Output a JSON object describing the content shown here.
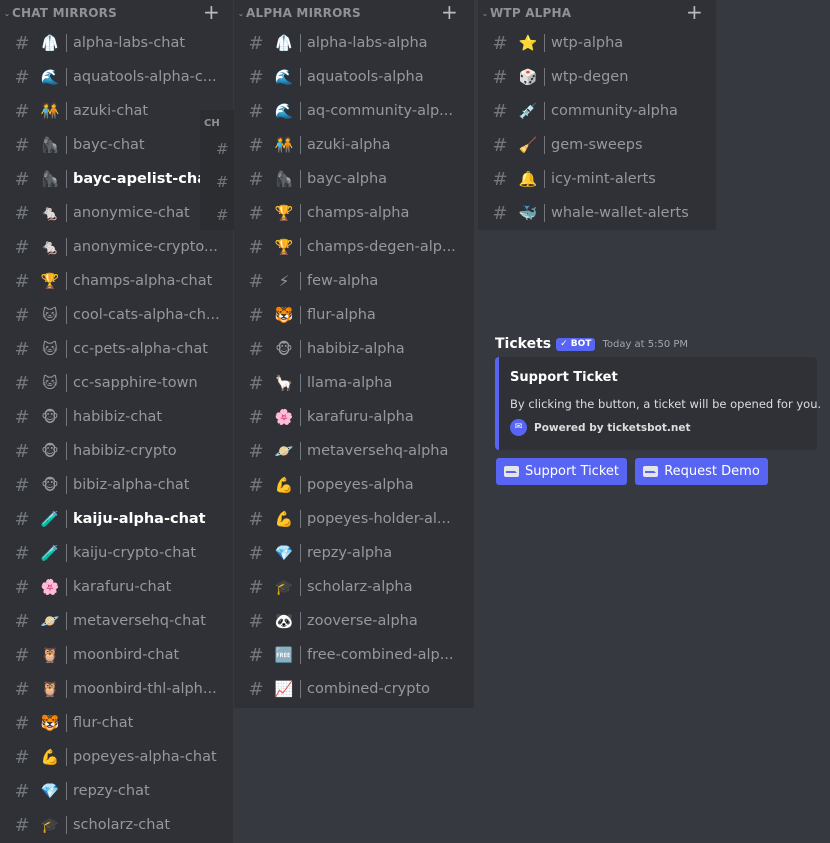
{
  "columns": [
    {
      "title": "CHAT MIRRORS",
      "add_glyph": "+",
      "channels": [
        {
          "emoji": "🥼",
          "label": "alpha-labs-chat",
          "active": false
        },
        {
          "emoji": "🌊",
          "label": "aquatools-alpha-c...",
          "active": false
        },
        {
          "emoji": "🧑‍🤝‍🧑",
          "label": "azuki-chat",
          "active": false
        },
        {
          "emoji": "🦍",
          "label": "bayc-chat",
          "active": false
        },
        {
          "emoji": "🦍",
          "label": "bayc-apelist-chat",
          "active": true
        },
        {
          "emoji": "🐁",
          "label": "anonymice-chat",
          "active": false
        },
        {
          "emoji": "🐁",
          "label": "anonymice-crypto...",
          "active": false
        },
        {
          "emoji": "🏆",
          "label": "champs-alpha-chat",
          "active": false
        },
        {
          "emoji": "🐱",
          "label": "cool-cats-alpha-ch...",
          "active": false
        },
        {
          "emoji": "🐱",
          "label": "cc-pets-alpha-chat",
          "active": false
        },
        {
          "emoji": "🐱",
          "label": "cc-sapphire-town",
          "active": false
        },
        {
          "emoji": "🐵",
          "label": "habibiz-chat",
          "active": false
        },
        {
          "emoji": "🐵",
          "label": "habibiz-crypto",
          "active": false
        },
        {
          "emoji": "🐵",
          "label": "bibiz-alpha-chat",
          "active": false
        },
        {
          "emoji": "🧪",
          "label": "kaiju-alpha-chat",
          "active": true
        },
        {
          "emoji": "🧪",
          "label": "kaiju-crypto-chat",
          "active": false
        },
        {
          "emoji": "🌸",
          "label": "karafuru-chat",
          "active": false
        },
        {
          "emoji": "🪐",
          "label": "metaversehq-chat",
          "active": false
        },
        {
          "emoji": "🦉",
          "label": "moonbird-chat",
          "active": false
        },
        {
          "emoji": "🦉",
          "label": "moonbird-thl-alph...",
          "active": false
        },
        {
          "emoji": "🐯",
          "label": "flur-chat",
          "active": false
        },
        {
          "emoji": "💪",
          "label": "popeyes-alpha-chat",
          "active": false
        },
        {
          "emoji": "💎",
          "label": "repzy-chat",
          "active": false
        },
        {
          "emoji": "🎓",
          "label": "scholarz-chat",
          "active": false
        }
      ]
    },
    {
      "title": "ALPHA MIRRORS",
      "add_glyph": "+",
      "channels": [
        {
          "emoji": "🥼",
          "label": "alpha-labs-alpha",
          "active": false
        },
        {
          "emoji": "🌊",
          "label": "aquatools-alpha",
          "active": false
        },
        {
          "emoji": "🌊",
          "label": "aq-community-alp...",
          "active": false
        },
        {
          "emoji": "🧑‍🤝‍🧑",
          "label": "azuki-alpha",
          "active": false
        },
        {
          "emoji": "🦍",
          "label": "bayc-alpha",
          "active": false
        },
        {
          "emoji": "🏆",
          "label": "champs-alpha",
          "active": false
        },
        {
          "emoji": "🏆",
          "label": "champs-degen-alp...",
          "active": false
        },
        {
          "emoji": "⚡",
          "label": "few-alpha",
          "active": false
        },
        {
          "emoji": "🐯",
          "label": "flur-alpha",
          "active": false
        },
        {
          "emoji": "🐵",
          "label": "habibiz-alpha",
          "active": false
        },
        {
          "emoji": "🦙",
          "label": "llama-alpha",
          "active": false
        },
        {
          "emoji": "🌸",
          "label": "karafuru-alpha",
          "active": false
        },
        {
          "emoji": "🪐",
          "label": "metaversehq-alpha",
          "active": false
        },
        {
          "emoji": "💪",
          "label": "popeyes-alpha",
          "active": false
        },
        {
          "emoji": "💪",
          "label": "popeyes-holder-al...",
          "active": false
        },
        {
          "emoji": "💎",
          "label": "repzy-alpha",
          "active": false
        },
        {
          "emoji": "🎓",
          "label": "scholarz-alpha",
          "active": false
        },
        {
          "emoji": "🐼",
          "label": "zooverse-alpha",
          "active": false
        },
        {
          "emoji": "🆓",
          "label": "free-combined-alp...",
          "active": false
        },
        {
          "emoji": "📈",
          "label": "combined-crypto",
          "active": false
        }
      ]
    },
    {
      "title": "WTP ALPHA",
      "add_glyph": "+",
      "channels": [
        {
          "emoji": "⭐",
          "label": "wtp-alpha",
          "active": false
        },
        {
          "emoji": "🎲",
          "label": "wtp-degen",
          "active": false
        },
        {
          "emoji": "💉",
          "label": "community-alpha",
          "active": false
        },
        {
          "emoji": "🧹",
          "label": "gem-sweeps",
          "active": false
        },
        {
          "emoji": "🔔",
          "label": "icy-mint-alerts",
          "active": false
        },
        {
          "emoji": "🐳",
          "label": "whale-wallet-alerts",
          "active": false
        }
      ]
    }
  ],
  "ghost_column": {
    "title": "CH",
    "hash_glyph": "#"
  },
  "hash_glyph": "#",
  "chevron_glyph": "⌄",
  "message": {
    "author": "Tickets",
    "bot_tag": "✓ BOT",
    "timestamp": "Today at 5:50 PM",
    "embed": {
      "title": "Support Ticket",
      "description": "By clicking the button, a ticket will be opened for you.",
      "footer_icon": "✉",
      "footer_text": "Powered by ticketsbot.net",
      "accent_color": "#5865f2"
    },
    "buttons": [
      {
        "label": "Support Ticket",
        "icon": "envelope-icon"
      },
      {
        "label": "Request Demo",
        "icon": "envelope-icon"
      }
    ]
  }
}
